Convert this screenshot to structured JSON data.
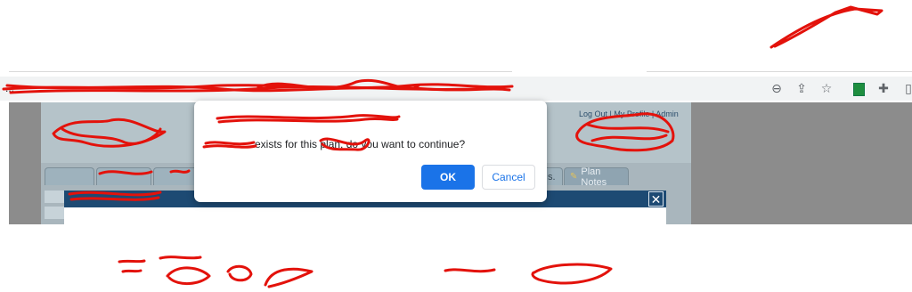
{
  "browser": {
    "url": "...",
    "icons": [
      "zoom-out-icon",
      "share-icon",
      "bookmark-star-icon",
      "extension-sheets-icon",
      "extensions-puzzle-icon",
      "side-panel-icon"
    ]
  },
  "page": {
    "top_links": "Log Out | My Profile | Admin",
    "tabs": {
      "plan_notes": "Plan Notes",
      "partial": "s."
    }
  },
  "dialog": {
    "message_visible": "exists for this plan, do you want to continue?",
    "ok_label": "OK",
    "cancel_label": "Cancel"
  },
  "modal": {
    "close_glyph": "✕"
  },
  "colors": {
    "accent": "#1a73e8",
    "overlay": "#8c8c8c",
    "modal_titlebar": "#1d4a73",
    "scribble": "#e3120b"
  }
}
